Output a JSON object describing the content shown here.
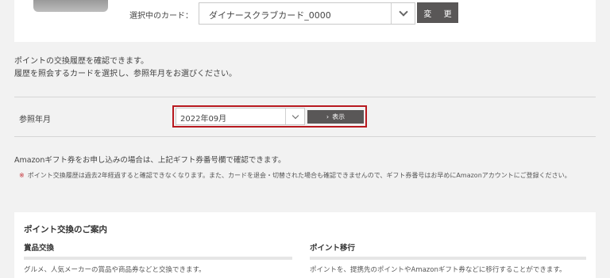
{
  "card_section": {
    "label": "選択中のカード：",
    "selected_card": "ダイナースクラブカード_0000",
    "change_label": "変 更"
  },
  "intro": {
    "line1": "ポイントの交換履歴を確認できます。",
    "line2": "履歴を照会するカードを選択し、参照年月をお選びください。"
  },
  "month_row": {
    "label": "参照年月",
    "selected_month": "2022年09月",
    "show_label": "表示"
  },
  "amazon_note": "Amazonギフト券をお申し込みの場合は、上記ギフト券番号欄で確認できます。",
  "warning": {
    "mark": "※",
    "text": "ポイント交換履歴は過去2年経過すると確認できなくなります。また、カードを退会・切替された場合も確認できませんので、ギフト券番号はお早めにAmazonアカウントにご登録ください。"
  },
  "guide": {
    "title": "ポイント交換のご案内",
    "col1": {
      "heading": "賞品交換",
      "text": "グルメ、人気メーカーの賞品や商品券などと交換できます。"
    },
    "col2": {
      "heading": "ポイント移行",
      "text": "ポイントを、提携先のポイントやAmazonギフト券などに移行することができます。"
    }
  },
  "colors": {
    "highlight": "#b8191f",
    "button": "#595757",
    "warning_mark": "#c0262d"
  }
}
